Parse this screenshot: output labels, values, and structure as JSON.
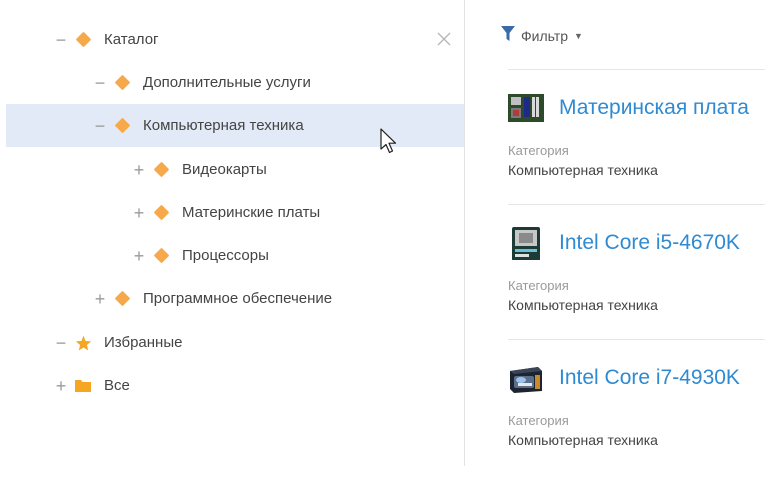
{
  "tree": {
    "items": [
      {
        "label": "Каталог",
        "toggle": "−",
        "icon": "diamond-icon"
      },
      {
        "label": "Дополнительные услуги",
        "toggle": "−",
        "icon": "diamond-icon"
      },
      {
        "label": "Компьютерная техника",
        "toggle": "−",
        "icon": "diamond-icon",
        "selected": true
      },
      {
        "label": "Видеокарты",
        "toggle": "+",
        "icon": "diamond-icon"
      },
      {
        "label": "Материнские платы",
        "toggle": "+",
        "icon": "diamond-icon"
      },
      {
        "label": "Процессоры",
        "toggle": "+",
        "icon": "diamond-icon"
      },
      {
        "label": "Программное обеспечение",
        "toggle": "+",
        "icon": "diamond-icon"
      },
      {
        "label": "Избранные",
        "toggle": "−",
        "icon": "star-icon"
      },
      {
        "label": "Все",
        "toggle": "+",
        "icon": "folder-icon"
      }
    ],
    "close_icon": "close-icon"
  },
  "filter": {
    "label": "Фильтр",
    "icon": "funnel-icon"
  },
  "products": [
    {
      "name": "Материнская плата",
      "category_label": "Категория",
      "category": "Компьютерная техника",
      "icon": "motherboard-icon"
    },
    {
      "name": "Intel Core i5-4670K",
      "category_label": "Категория",
      "category": "Компьютерная техника",
      "icon": "cpu-box-icon"
    },
    {
      "name": "Intel Core i7-4930K",
      "category_label": "Категория",
      "category": "Компьютерная техника",
      "icon": "intel-core-box-icon"
    }
  ],
  "colors": {
    "accent": "#2f8ad2",
    "diamond": "#f7a94a",
    "selected_row": "#e2e9f7"
  }
}
